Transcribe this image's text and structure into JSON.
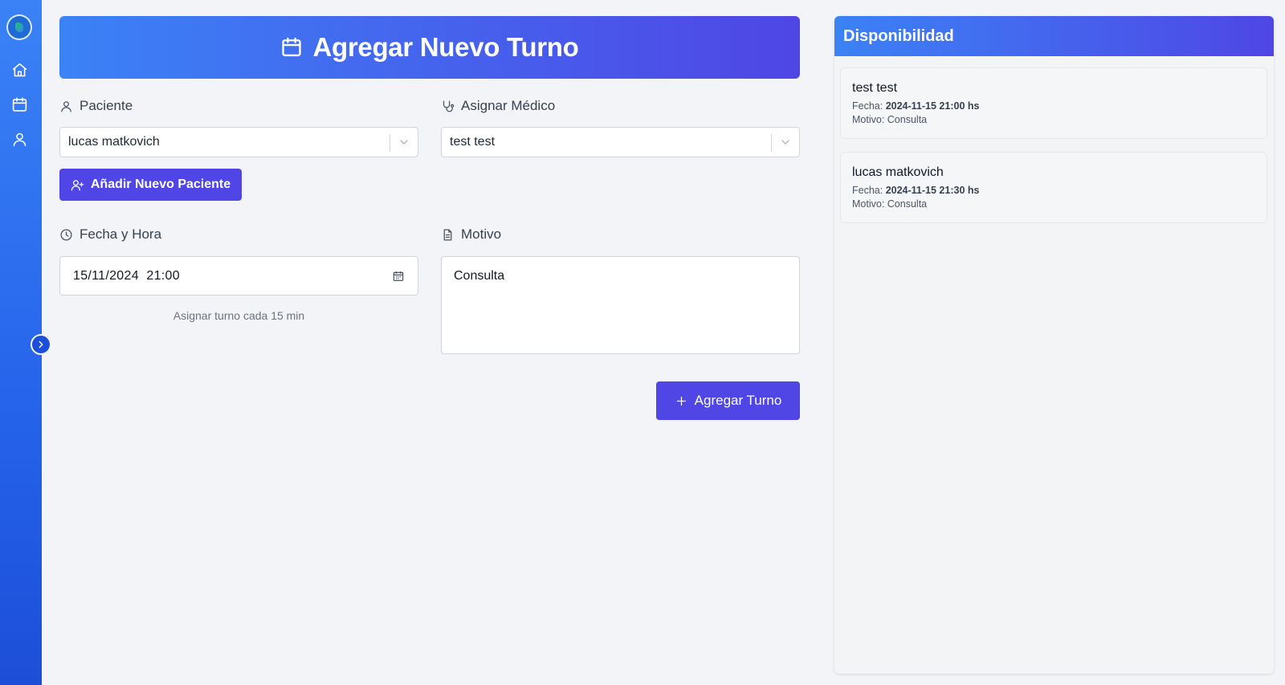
{
  "sidebar": {
    "logo_name": "app-logo",
    "items": [
      {
        "icon": "home-icon"
      },
      {
        "icon": "calendar-icon"
      },
      {
        "icon": "user-icon"
      }
    ],
    "toggle_icon": "chevron-right-icon"
  },
  "header": {
    "title": "Agregar Nuevo Turno",
    "icon": "calendar-icon"
  },
  "form": {
    "patient": {
      "label": "Paciente",
      "value": "lucas matkovich"
    },
    "doctor": {
      "label": "Asignar Médico",
      "value": "test test"
    },
    "add_patient_button": "Añadir Nuevo Paciente",
    "datetime": {
      "label": "Fecha y Hora",
      "value": "15/11/2024  21:00",
      "hint": "Asignar turno cada 15 min"
    },
    "reason": {
      "label": "Motivo",
      "value": "Consulta"
    },
    "submit_button": "Agregar Turno"
  },
  "availability": {
    "title": "Disponibilidad",
    "date_label": "Fecha:",
    "reason_label": "Motivo:",
    "items": [
      {
        "name": "test test",
        "date": "2024-11-15 21:00 hs",
        "reason": "Consulta"
      },
      {
        "name": "lucas matkovich",
        "date": "2024-11-15 21:30 hs",
        "reason": "Consulta"
      }
    ]
  },
  "colors": {
    "primary": "#4f46e5",
    "gradient_start": "#3b82f6",
    "background": "#f2f4f7"
  }
}
